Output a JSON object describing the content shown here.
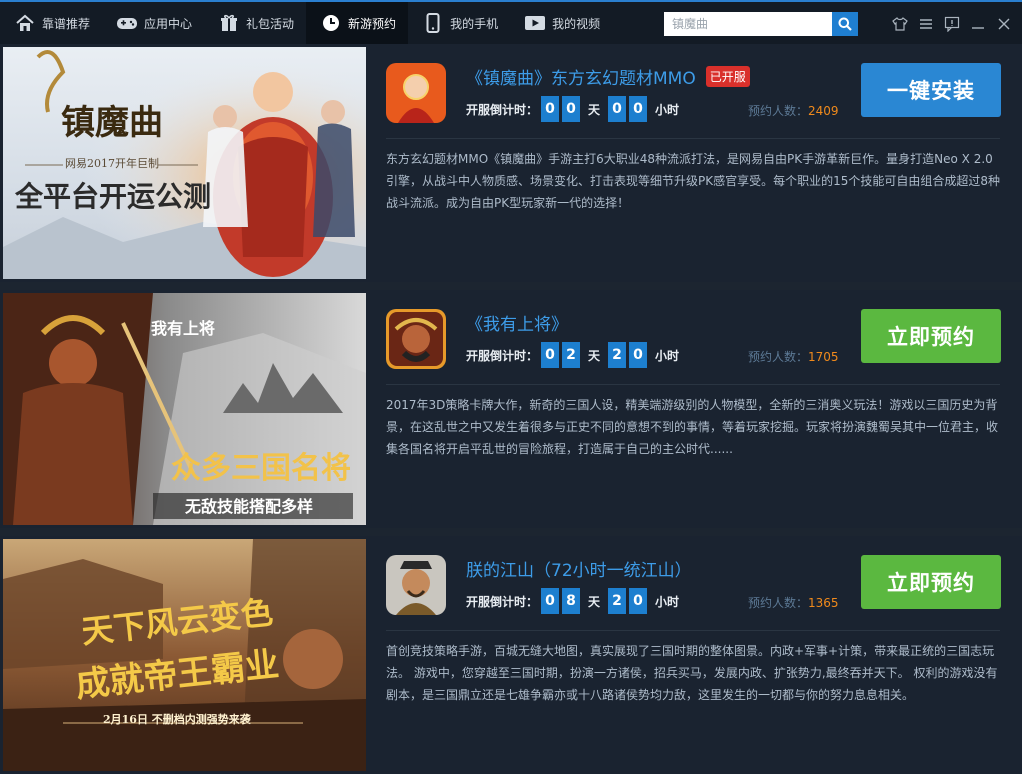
{
  "nav": {
    "items": [
      {
        "label": "靠谱推荐",
        "icon": "home-icon"
      },
      {
        "label": "应用中心",
        "icon": "gamepad-icon"
      },
      {
        "label": "礼包活动",
        "icon": "gift-icon"
      },
      {
        "label": "新游预约",
        "icon": "clock-icon"
      },
      {
        "label": "我的手机",
        "icon": "phone-icon"
      },
      {
        "label": "我的视频",
        "icon": "video-icon"
      }
    ],
    "active_index": 3
  },
  "search": {
    "placeholder": "镇魔曲",
    "icon": "search-icon"
  },
  "window_controls": [
    "skin-icon",
    "menu-icon",
    "feedback-icon",
    "minimize-icon",
    "close-icon"
  ],
  "countdown_label": "开服倒计时：",
  "unit_day": "天",
  "unit_hour": "小时",
  "count_prefix": "预约人数：",
  "games": [
    {
      "name": "《镇魔曲》东方玄幻题材MMO",
      "badge": "已开服",
      "days": [
        "0",
        "0"
      ],
      "hours": [
        "0",
        "0"
      ],
      "reservations": "2409",
      "button": "一键安装",
      "button_color": "#2a87d3",
      "banner_lines": [
        "镇魔曲",
        "网易2017开年巨制",
        "全平台开运公测"
      ],
      "description": "东方玄幻题材MMO《镇魔曲》手游主打6大职业48种流派打法，是网易自由PK手游革新巨作。量身打造Neo X 2.0引擎，从战斗中人物质感、场景变化、打击表现等细节升级PK感官享受。每个职业的15个技能可自由组合成超过8种战斗流派。成为自由PK型玩家新一代的选择！"
    },
    {
      "name": "《我有上将》",
      "badge": "",
      "days": [
        "0",
        "2"
      ],
      "hours": [
        "2",
        "0"
      ],
      "reservations": "1705",
      "button": "立即预约",
      "button_color": "#5bb840",
      "banner_lines": [
        "我有上将",
        "众多三国名将",
        "无敌技能搭配多样"
      ],
      "description": "2017年3D策略卡牌大作，新奇的三国人设，精美端游级别的人物模型，全新的三消奥义玩法！游戏以三国历史为背景，在这乱世之中又发生着很多与正史不同的意想不到的事情，等着玩家挖掘。玩家将扮演魏蜀吴其中一位君主，收集各国名将开启平乱世的冒险旅程，打造属于自己的主公时代......"
    },
    {
      "name": "朕的江山（72小时一统江山）",
      "badge": "",
      "days": [
        "0",
        "8"
      ],
      "hours": [
        "2",
        "0"
      ],
      "reservations": "1365",
      "button": "立即预约",
      "button_color": "#5bb840",
      "banner_lines": [
        "天下风云变色",
        "成就帝王霸业",
        "2月16日 不删档内测强势来袭"
      ],
      "description": "首创竞技策略手游，百城无缝大地图，真实展现了三国时期的整体图景。内政+军事+计策，带来最正统的三国志玩法。 游戏中，您穿越至三国时期，扮演一方诸侯，招兵买马，发展内政、扩张势力,最终吞并天下。 权利的游戏没有剧本，是三国鼎立还是七雄争霸亦或十八路诸侯势均力敌，这里发生的一切都与你的努力息息相关。"
    }
  ]
}
